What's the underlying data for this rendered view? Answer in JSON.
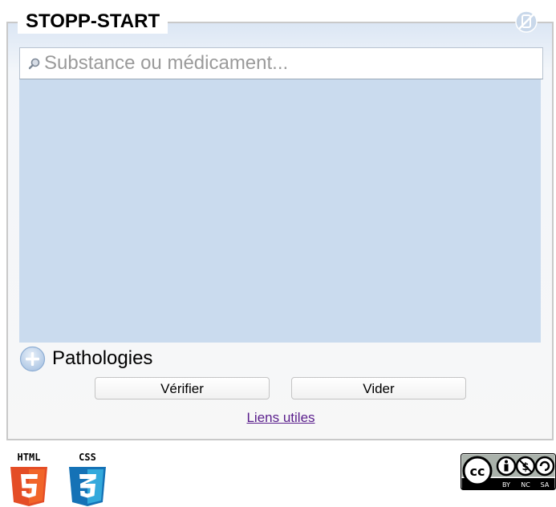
{
  "app": {
    "title": "STOPP-START"
  },
  "search": {
    "placeholder": "Substance ou médicament...",
    "value": ""
  },
  "pathologies": {
    "label": "Pathologies"
  },
  "actions": {
    "verify_label": "Vérifier",
    "clear_label": "Vider"
  },
  "links": {
    "useful_links": "Liens utiles"
  },
  "footer": {
    "html5_badge": "HTML",
    "css3_badge": "CSS",
    "license_badge": "BY NC SA"
  },
  "colors": {
    "results_background": "#cadbee",
    "panel_border": "#c9c9c9",
    "link": "#5a1e8c",
    "html5_orange": "#e44d26",
    "css3_blue": "#1572b6"
  },
  "icons": {
    "corner": "no-edit-icon",
    "search": "search-icon",
    "pathologies": "plus-circle-icon"
  }
}
